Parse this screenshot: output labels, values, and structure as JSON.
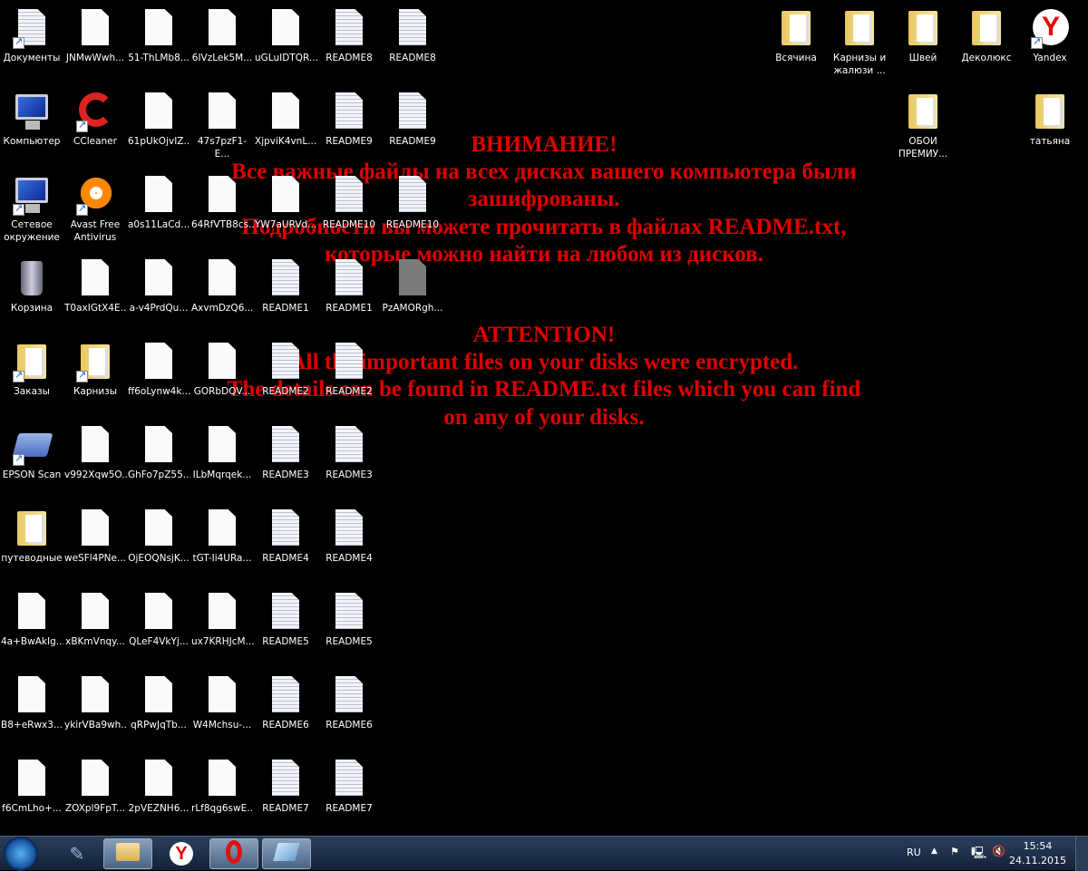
{
  "wallpaper_message": {
    "ru": [
      "ВНИМАНИЕ!",
      "Все важные файлы на всех дисках вашего компьютера были",
      "зашифрованы.",
      "Подробности вы можете прочитать в файлах README.txt,",
      "которые можно найти на любом из дисков."
    ],
    "en": [
      "ATTENTION!",
      "All the important files on your disks were encrypted.",
      "The details can be found in README.txt files which you can find",
      "on any of your disks."
    ],
    "color": "#e00000"
  },
  "desktop_left_columns": [
    [
      {
        "label": "Документы",
        "icon": "documents"
      },
      {
        "label": "Компьютер",
        "icon": "computer"
      },
      {
        "label": "Сетевое окружение",
        "icon": "network"
      },
      {
        "label": "Корзина",
        "icon": "recycle-bin"
      },
      {
        "label": "Заказы",
        "icon": "folder-shortcut"
      },
      {
        "label": "EPSON Scan",
        "icon": "scanner"
      },
      {
        "label": "путеводные",
        "icon": "folder"
      },
      {
        "label": "4a+BwAkIg...",
        "icon": "file"
      },
      {
        "label": "B8+eRwx3...",
        "icon": "file"
      },
      {
        "label": "f6CmLho+...",
        "icon": "file"
      }
    ],
    [
      {
        "label": "JNMwWwh...",
        "icon": "file"
      },
      {
        "label": "CCleaner",
        "icon": "ccleaner"
      },
      {
        "label": "Avast Free Antivirus",
        "icon": "avast"
      },
      {
        "label": "T0axIGtX4E...",
        "icon": "file"
      },
      {
        "label": "Карнизы",
        "icon": "folder-shortcut"
      },
      {
        "label": "v992Xqw5O...",
        "icon": "file"
      },
      {
        "label": "weSFl4PNe...",
        "icon": "file"
      },
      {
        "label": "xBKmVnqy...",
        "icon": "file"
      },
      {
        "label": "ykirVBa9wh...",
        "icon": "file"
      },
      {
        "label": "ZOXpl9FpT...",
        "icon": "file"
      }
    ],
    [
      {
        "label": "51-ThLMb8...",
        "icon": "file"
      },
      {
        "label": "61pUkOjvIZ...",
        "icon": "file"
      },
      {
        "label": "a0s11LaCd...",
        "icon": "file"
      },
      {
        "label": "a-v4PrdQu...",
        "icon": "file"
      },
      {
        "label": "ff6oLynw4k...",
        "icon": "file"
      },
      {
        "label": "GhFo7pZ55...",
        "icon": "file"
      },
      {
        "label": "OjEOQNsjK...",
        "icon": "file"
      },
      {
        "label": "QLeF4VkYj...",
        "icon": "file"
      },
      {
        "label": "qRPwJqTb...",
        "icon": "file"
      },
      {
        "label": "2pVEZNH6...",
        "icon": "file"
      }
    ],
    [
      {
        "label": "6IVzLek5M...",
        "icon": "file"
      },
      {
        "label": "47s7pzF1-E...",
        "icon": "file"
      },
      {
        "label": "64RfVTB8cs...",
        "icon": "file"
      },
      {
        "label": "AxvmDzQ6...",
        "icon": "file"
      },
      {
        "label": "GORbDQV...",
        "icon": "file"
      },
      {
        "label": "ILbMqrqek...",
        "icon": "file"
      },
      {
        "label": "tGT-Ii4URa...",
        "icon": "file"
      },
      {
        "label": "ux7KRHJcM...",
        "icon": "file"
      },
      {
        "label": "W4Mchsu-...",
        "icon": "file"
      },
      {
        "label": "rLf8qg6swE...",
        "icon": "file"
      }
    ],
    [
      {
        "label": "uGLuIDTQR...",
        "icon": "file"
      },
      {
        "label": "XjpviK4vnL...",
        "icon": "file"
      },
      {
        "label": "YW7aURVd...",
        "icon": "file"
      },
      {
        "label": "README1",
        "icon": "text-file"
      },
      {
        "label": "README2",
        "icon": "text-file"
      },
      {
        "label": "README3",
        "icon": "text-file"
      },
      {
        "label": "README4",
        "icon": "text-file"
      },
      {
        "label": "README5",
        "icon": "text-file"
      },
      {
        "label": "README6",
        "icon": "text-file"
      },
      {
        "label": "README7",
        "icon": "text-file"
      }
    ],
    [
      {
        "label": "README8",
        "icon": "text-file"
      },
      {
        "label": "README9",
        "icon": "text-file"
      },
      {
        "label": "README10",
        "icon": "text-file"
      },
      {
        "label": "README1",
        "icon": "text-file"
      },
      {
        "label": "README2",
        "icon": "text-file"
      },
      {
        "label": "README3",
        "icon": "text-file"
      },
      {
        "label": "README4",
        "icon": "text-file"
      },
      {
        "label": "README5",
        "icon": "text-file"
      },
      {
        "label": "README6",
        "icon": "text-file"
      },
      {
        "label": "README7",
        "icon": "text-file"
      }
    ],
    [
      {
        "label": "README8",
        "icon": "text-file"
      },
      {
        "label": "README9",
        "icon": "text-file"
      },
      {
        "label": "README10",
        "icon": "text-file"
      },
      {
        "label": "PzAMORgh...",
        "icon": "gray-file"
      }
    ]
  ],
  "desktop_right_rows": [
    [
      {
        "label": "Всячина",
        "icon": "folder"
      },
      {
        "label": "Карнизы и жалюзи ...",
        "icon": "folder"
      },
      {
        "label": "Швей",
        "icon": "folder"
      },
      {
        "label": "Деколюкс",
        "icon": "folder"
      },
      {
        "label": "Yandex",
        "icon": "yandex"
      }
    ],
    [
      null,
      null,
      {
        "label": "ОБОИ ПРЕМИУ...",
        "icon": "folder"
      },
      null,
      {
        "label": "татьяна",
        "icon": "folder"
      }
    ]
  ],
  "taskbar": {
    "pinned": [
      {
        "name": "scanner",
        "active": false
      },
      {
        "name": "explorer",
        "active": true
      },
      {
        "name": "yandex-browser",
        "active": false
      },
      {
        "name": "opera",
        "active": true
      },
      {
        "name": "app",
        "active": true
      }
    ],
    "language": "RU",
    "time": "15:54",
    "date": "24.11.2015"
  }
}
